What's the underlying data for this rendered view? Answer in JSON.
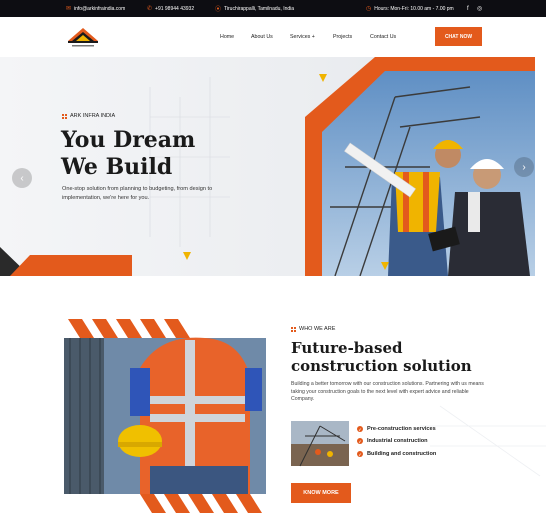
{
  "topbar": {
    "email": "info@arkinfraindia.com",
    "phone": "+91 98944 43932",
    "location": "Tiruchirappalli, Tamilnadu, India",
    "hours": "Hours: Mon-Fri: 10.00 am - 7.00 pm",
    "social_facebook": "f",
    "social_instagram": "◎"
  },
  "nav": {
    "items": [
      "Home",
      "About Us",
      "Services +",
      "Projects",
      "Contact Us"
    ],
    "cta": "CHAT NOW"
  },
  "hero": {
    "eyebrow": "ARK INFRA INDIA",
    "title_line1": "You Dream",
    "title_line2": "We Build",
    "subtitle": "One-stop solution from planning to budgeting, from design to implementation, we're here for you.",
    "prev_arrow": "‹",
    "next_arrow": "›"
  },
  "about": {
    "eyebrow": "WHO WE ARE",
    "title": "Future-based construction solution",
    "text": "Building a better tomorrow with our construction solutions. Partnering with us means taking your construction goals to the next level with expert advice and reliable Company.",
    "features": [
      "Pre-construction services",
      "Industrial construction",
      "Building and construction"
    ],
    "cta": "KNOW MORE"
  },
  "colors": {
    "accent": "#e35a1c",
    "topbar": "#0d0d12",
    "gold": "#f0b400"
  }
}
